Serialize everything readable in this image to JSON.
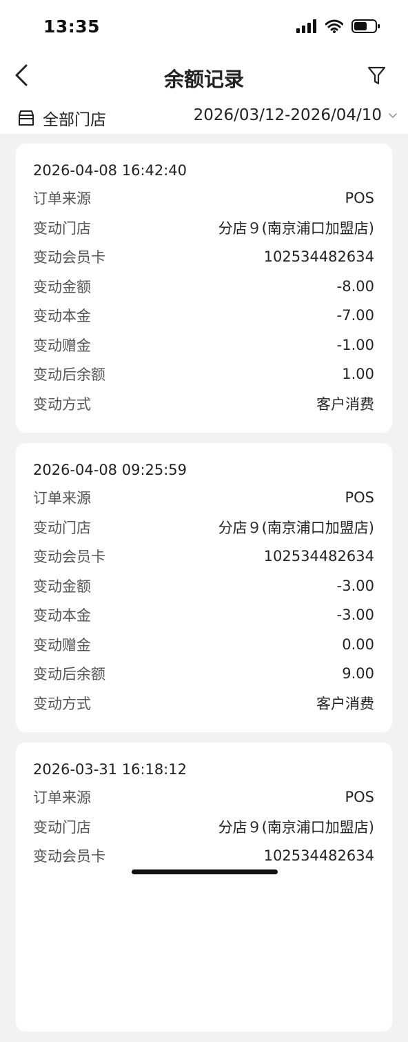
{
  "status_bar": {
    "time": "13:35"
  },
  "nav": {
    "title": "余额记录"
  },
  "filters": {
    "store_label": "全部门店",
    "date_range": "2026/03/12-2026/04/10"
  },
  "field_labels": {
    "source": "订单来源",
    "store": "变动门店",
    "card": "变动会员卡",
    "amount": "变动金额",
    "principal": "变动本金",
    "bonus": "变动赠金",
    "balance_after": "变动后余额",
    "method": "变动方式"
  },
  "records": [
    {
      "time": "2026-04-08 16:42:40",
      "source": "POS",
      "store": "分店９(南京浦口加盟店)",
      "card": "102534482634",
      "amount": "-8.00",
      "principal": "-7.00",
      "bonus": "-1.00",
      "balance_after": "1.00",
      "method": "客户消费"
    },
    {
      "time": "2026-04-08 09:25:59",
      "source": "POS",
      "store": "分店９(南京浦口加盟店)",
      "card": "102534482634",
      "amount": "-3.00",
      "principal": "-3.00",
      "bonus": "0.00",
      "balance_after": "9.00",
      "method": "客户消费"
    },
    {
      "time": "2026-03-31 16:18:12",
      "source": "POS",
      "store": "分店９(南京浦口加盟店)",
      "card": "102534482634"
    }
  ]
}
